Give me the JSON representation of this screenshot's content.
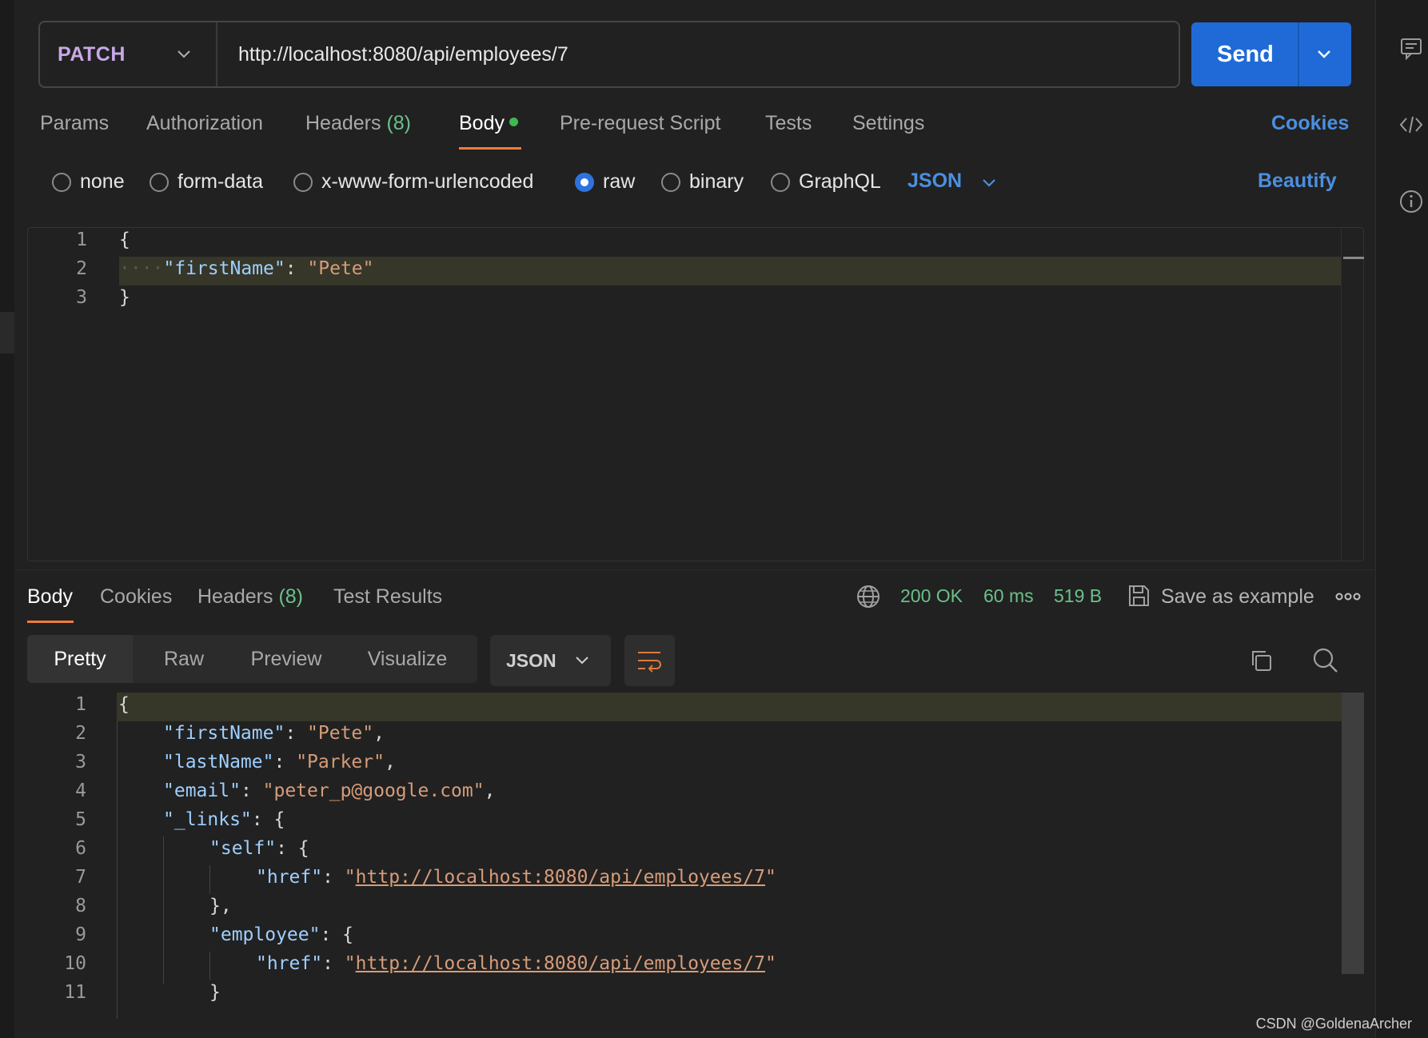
{
  "request": {
    "method": "PATCH",
    "url": "http://localhost:8080/api/employees/7",
    "send_label": "Send",
    "tabs": [
      {
        "label": "Params",
        "count": ""
      },
      {
        "label": "Authorization",
        "count": ""
      },
      {
        "label": "Headers",
        "count": "(8)"
      },
      {
        "label": "Body",
        "count": "",
        "active": true
      },
      {
        "label": "Pre-request Script",
        "count": ""
      },
      {
        "label": "Tests",
        "count": ""
      },
      {
        "label": "Settings",
        "count": ""
      }
    ],
    "cookies_label": "Cookies",
    "body_types": [
      "none",
      "form-data",
      "x-www-form-urlencoded",
      "raw",
      "binary",
      "GraphQL"
    ],
    "selected_body_type": "raw",
    "language": "JSON",
    "beautify_label": "Beautify",
    "body_lines": [
      {
        "n": "1"
      },
      {
        "n": "2"
      },
      {
        "n": "3"
      }
    ],
    "body_text": {
      "open": "{",
      "key": "\"firstName\"",
      "colon": ": ",
      "value": "\"Pete\"",
      "close": "}"
    }
  },
  "response": {
    "tabs": [
      {
        "label": "Body",
        "count": ""
      },
      {
        "label": "Cookies",
        "count": ""
      },
      {
        "label": "Headers",
        "count": "(8)"
      },
      {
        "label": "Test Results",
        "count": ""
      }
    ],
    "status": "200 OK",
    "time": "60 ms",
    "size": "519 B",
    "save_label": "Save as example",
    "view_options": [
      "Pretty",
      "Raw",
      "Preview",
      "Visualize"
    ],
    "format": "JSON",
    "line_numbers": [
      "1",
      "2",
      "3",
      "4",
      "5",
      "6",
      "7",
      "8",
      "9",
      "10",
      "11"
    ],
    "json": {
      "firstName_key": "\"firstName\"",
      "firstName_val": "\"Pete\"",
      "lastName_key": "\"lastName\"",
      "lastName_val": "\"Parker\"",
      "email_key": "\"email\"",
      "email_val": "\"peter_p@google.com\"",
      "links_key": "\"_links\"",
      "self_key": "\"self\"",
      "href_key": "\"href\"",
      "href_url": "http://localhost:8080/api/employees/7",
      "employee_key": "\"employee\""
    }
  },
  "watermark": "CSDN @GoldenaArcher",
  "colors": {
    "accent": "#1f6ad6",
    "method": "#c9a8e8",
    "link": "#4b8fe0",
    "success": "#6cc08a",
    "tab_underline": "#f07c3b"
  }
}
